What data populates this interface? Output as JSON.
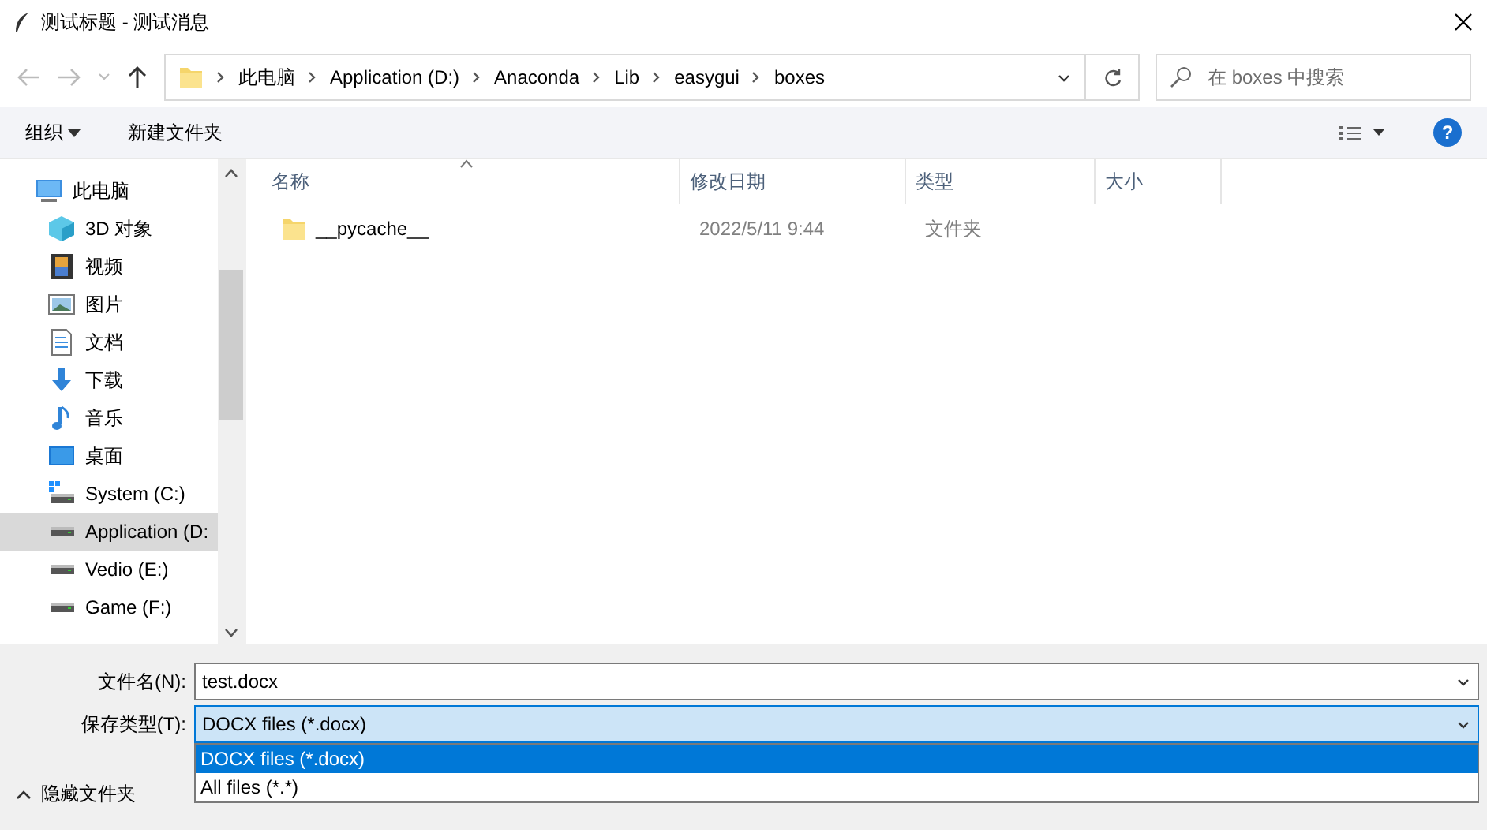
{
  "window": {
    "title": "测试标题 - 测试消息"
  },
  "address_bar": {
    "crumbs": [
      "此电脑",
      "Application (D:)",
      "Anaconda",
      "Lib",
      "easygui",
      "boxes"
    ]
  },
  "search": {
    "placeholder": "在 boxes 中搜索"
  },
  "toolbar": {
    "organize": "组织",
    "new_folder": "新建文件夹",
    "help": "?"
  },
  "sidebar": {
    "items": [
      {
        "label": "此电脑",
        "kind": "pc",
        "selected": false,
        "children": [
          {
            "label": "3D 对象",
            "kind": "cube",
            "selected": false
          },
          {
            "label": "视频",
            "kind": "film",
            "selected": false
          },
          {
            "label": "图片",
            "kind": "picture",
            "selected": false
          },
          {
            "label": "文档",
            "kind": "doc",
            "selected": false
          },
          {
            "label": "下载",
            "kind": "download",
            "selected": false
          },
          {
            "label": "音乐",
            "kind": "music",
            "selected": false
          },
          {
            "label": "桌面",
            "kind": "desktop",
            "selected": false
          },
          {
            "label": "System (C:)",
            "kind": "sysdrive",
            "selected": false
          },
          {
            "label": "Application (D:",
            "kind": "drive",
            "selected": true
          },
          {
            "label": "Vedio (E:)",
            "kind": "drive",
            "selected": false
          },
          {
            "label": "Game (F:)",
            "kind": "drive",
            "selected": false
          }
        ]
      }
    ]
  },
  "file_list": {
    "columns": [
      "名称",
      "修改日期",
      "类型",
      "大小"
    ],
    "rows": [
      {
        "name": "__pycache__",
        "modified": "2022/5/11 9:44",
        "type": "文件夹"
      }
    ]
  },
  "filename": {
    "label": "文件名(N):",
    "value": "test.docx"
  },
  "save_type": {
    "label": "保存类型(T):",
    "value": "DOCX files (*.docx)",
    "options": [
      {
        "label": "DOCX files (*.docx)",
        "selected": true
      },
      {
        "label": "All files (*.*)",
        "selected": false
      }
    ]
  },
  "hide_folders": "隐藏文件夹"
}
